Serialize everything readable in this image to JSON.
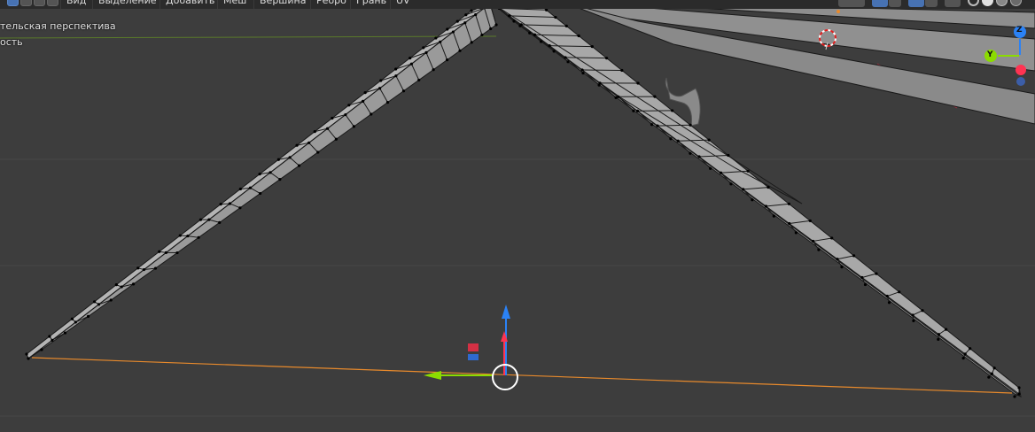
{
  "header": {
    "menu": {
      "view": "Вид",
      "select": "Выделение",
      "add": "Добавить",
      "mesh": "Меш",
      "vertex": "Вершина",
      "edge": "Ребро",
      "face": "Грань",
      "uv": "UV"
    }
  },
  "overlay": {
    "view_name": "тельская перспектива",
    "mode_text": "ость"
  },
  "gizmo": {
    "z_label": "Z",
    "y_label": "Y"
  },
  "colors": {
    "background": "#3d3d3d",
    "mesh_fill": "#8c8c8c",
    "mesh_wire": "#1a1a1a",
    "vertex": "#000000",
    "axis_x": "#ff3352",
    "axis_y": "#8bdc00",
    "axis_z": "#2b82f5",
    "selection_line": "#e88a2c"
  }
}
